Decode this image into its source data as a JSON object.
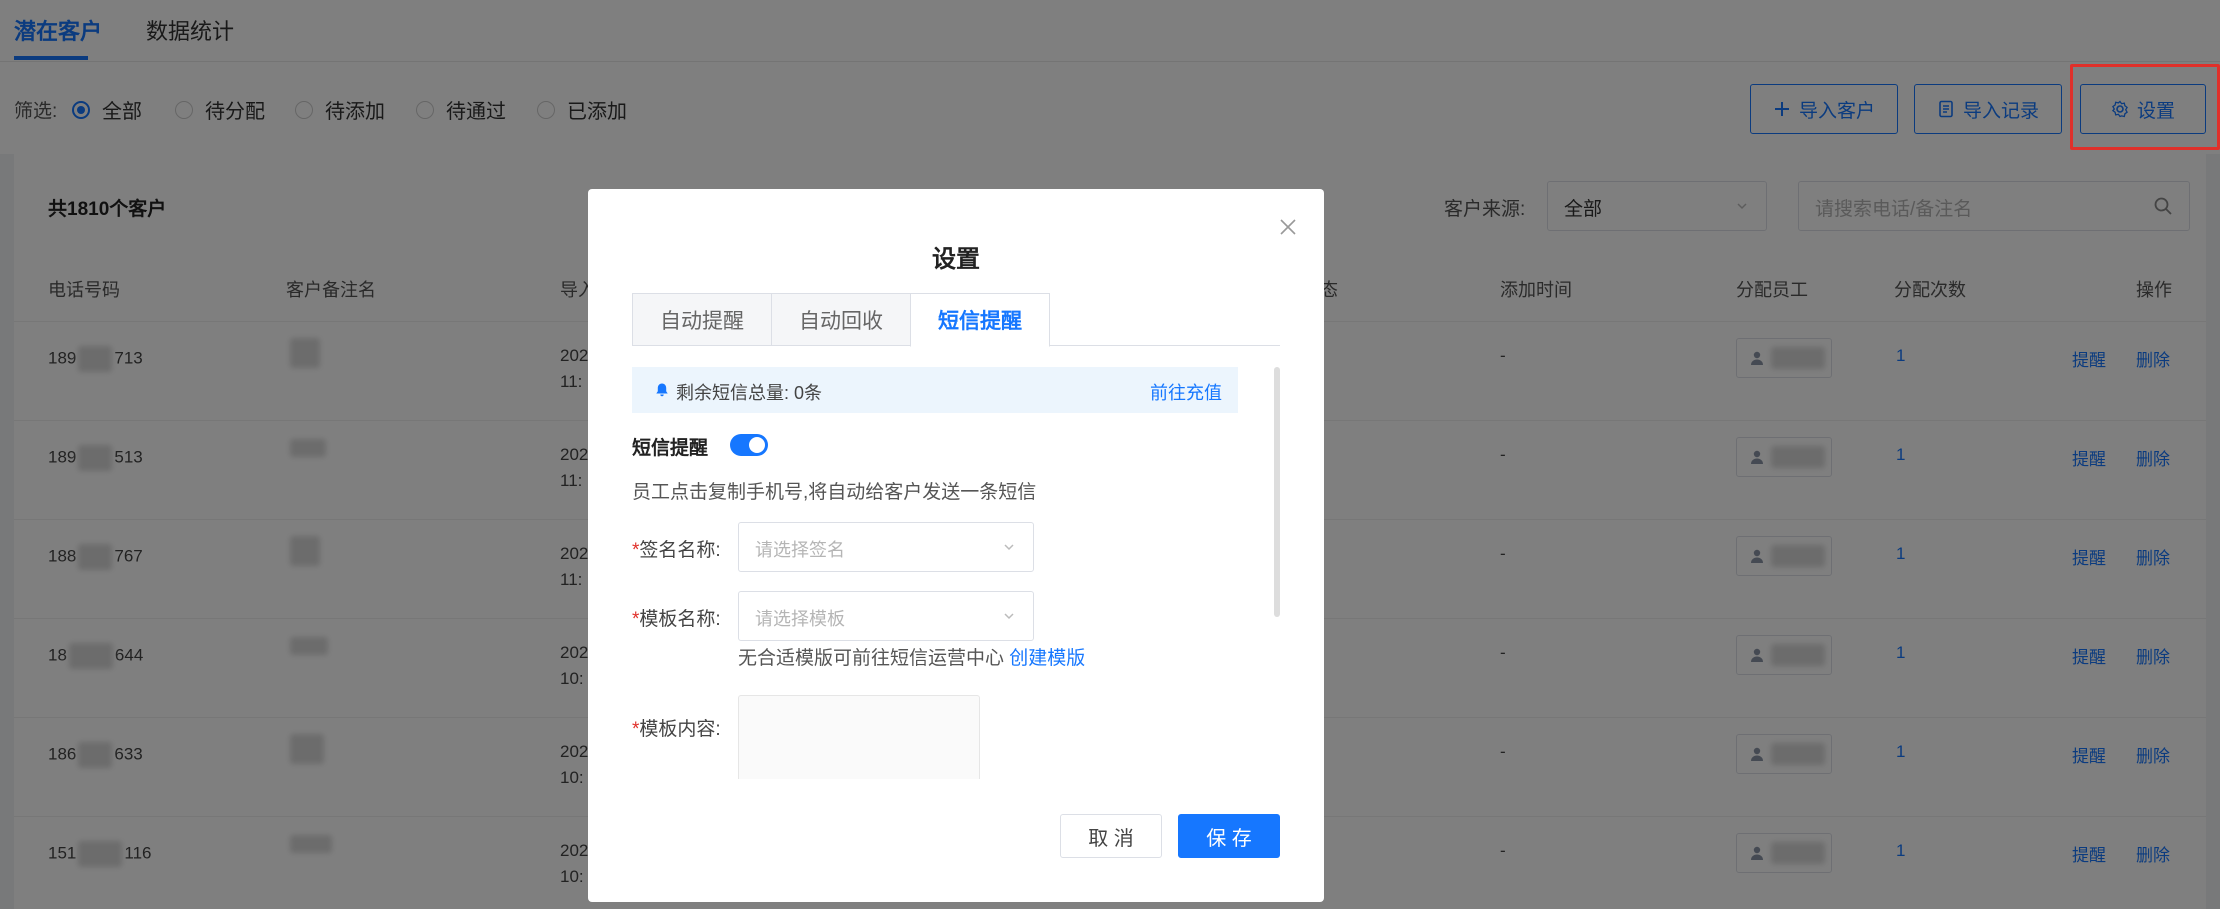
{
  "top_tabs": [
    "潜在客户",
    "数据统计"
  ],
  "filter": {
    "label": "筛选:",
    "options": [
      "全部",
      "待分配",
      "待添加",
      "待通过",
      "已添加"
    ],
    "selected": "全部"
  },
  "toolbar": {
    "import_customers": "导入客户",
    "import_records": "导入记录",
    "settings": "设置"
  },
  "summary": {
    "total": "共1810个客户"
  },
  "source": {
    "label": "客户来源:",
    "value": "全部"
  },
  "search": {
    "placeholder": "请搜索电话/备注名"
  },
  "table": {
    "columns": [
      "电话号码",
      "客户备注名",
      "导入",
      "态",
      "添加时间",
      "分配员工",
      "分配次数",
      "操作"
    ],
    "rows": [
      {
        "phone_prefix": "189",
        "phone_suffix": "713",
        "time_line1": "202",
        "time_line2": "11:",
        "added": "-",
        "count": "1",
        "remind": "提醒",
        "delete": "删除"
      },
      {
        "phone_prefix": "189",
        "phone_suffix": "513",
        "time_line1": "202",
        "time_line2": "11:",
        "added": "-",
        "count": "1",
        "remind": "提醒",
        "delete": "删除"
      },
      {
        "phone_prefix": "188",
        "phone_suffix": "767",
        "time_line1": "202",
        "time_line2": "11:",
        "added": "-",
        "count": "1",
        "remind": "提醒",
        "delete": "删除"
      },
      {
        "phone_prefix": "18",
        "phone_suffix": "644",
        "time_line1": "202",
        "time_line2": "10:",
        "added": "-",
        "count": "1",
        "remind": "提醒",
        "delete": "删除"
      },
      {
        "phone_prefix": "186",
        "phone_suffix": "633",
        "time_line1": "202",
        "time_line2": "10:",
        "added": "-",
        "count": "1",
        "remind": "提醒",
        "delete": "删除"
      },
      {
        "phone_prefix": "151",
        "phone_suffix": "116",
        "time_line1": "202",
        "time_line2": "10:",
        "added": "-",
        "count": "1",
        "remind": "提醒",
        "delete": "删除"
      }
    ]
  },
  "modal": {
    "title": "设置",
    "tabs": [
      "自动提醒",
      "自动回收",
      "短信提醒"
    ],
    "active_tab": "短信提醒",
    "sms_remaining": "剩余短信总量: 0条",
    "recharge": "前往充值",
    "sms_label": "短信提醒",
    "sms_enabled": true,
    "description": "员工点击复制手机号,将自动给客户发送一条短信",
    "signature_label": "签名名称:",
    "signature_placeholder": "请选择签名",
    "template_label": "模板名称:",
    "template_placeholder": "请选择模板",
    "hint_text": "无合适模版可前往短信运营中心",
    "hint_link": "创建模版",
    "content_label": "模板内容:",
    "required_mark": "*",
    "cancel": "取 消",
    "save": "保 存"
  },
  "colors": {
    "accent": "#1677ff",
    "danger": "#e0302a"
  }
}
